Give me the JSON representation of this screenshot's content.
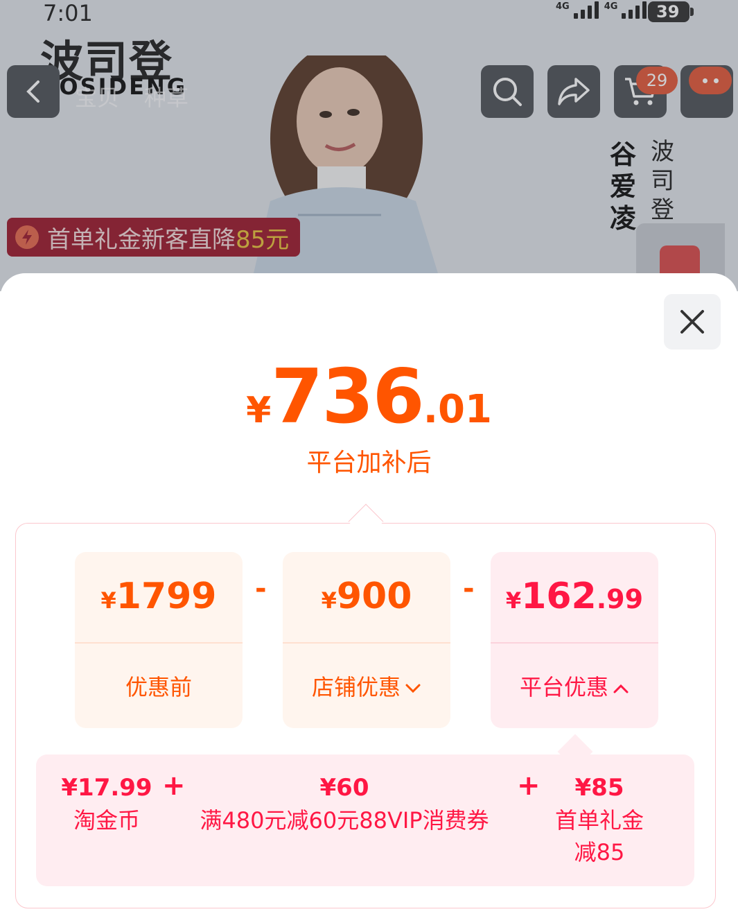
{
  "status_bar": {
    "time": "7:01",
    "network_1": "4G",
    "network_2": "4G",
    "battery": "39"
  },
  "background_page": {
    "brand_cn": "波司登",
    "brand_en": "BOSIDENG",
    "nav_tabs": [
      "宝贝",
      "种草"
    ],
    "cart_count": "29",
    "ambassador_name": "谷爱凌",
    "ambassador_title": "波司登品牌",
    "promo_tag": {
      "text": "首单礼金新客直降",
      "amount": "85元"
    }
  },
  "price_sheet": {
    "final_price": {
      "currency": "¥",
      "integer": "736",
      "decimal": ".01"
    },
    "final_label": "平台加补后",
    "cards": {
      "before": {
        "currency": "¥",
        "integer": "1799",
        "decimal": "",
        "label": "优惠前"
      },
      "store": {
        "currency": "¥",
        "integer": "900",
        "decimal": "",
        "label": "店铺优惠"
      },
      "platform": {
        "currency": "¥",
        "integer": "162",
        "decimal": ".99",
        "label": "平台优惠"
      }
    },
    "operators": {
      "minus": "-",
      "plus": "+"
    },
    "platform_details": [
      {
        "amount": "¥17.99",
        "desc": "淘金币"
      },
      {
        "amount": "¥60",
        "desc": "满480元减60元88VIP消费券"
      },
      {
        "amount": "¥85",
        "desc_line1": "首单礼金",
        "desc_line2": "减85"
      }
    ]
  },
  "colors": {
    "accent_orange": "#ff5500",
    "accent_red": "#ff1744",
    "card_bg": "#fff5ee",
    "platform_bg": "#ffedf1"
  }
}
